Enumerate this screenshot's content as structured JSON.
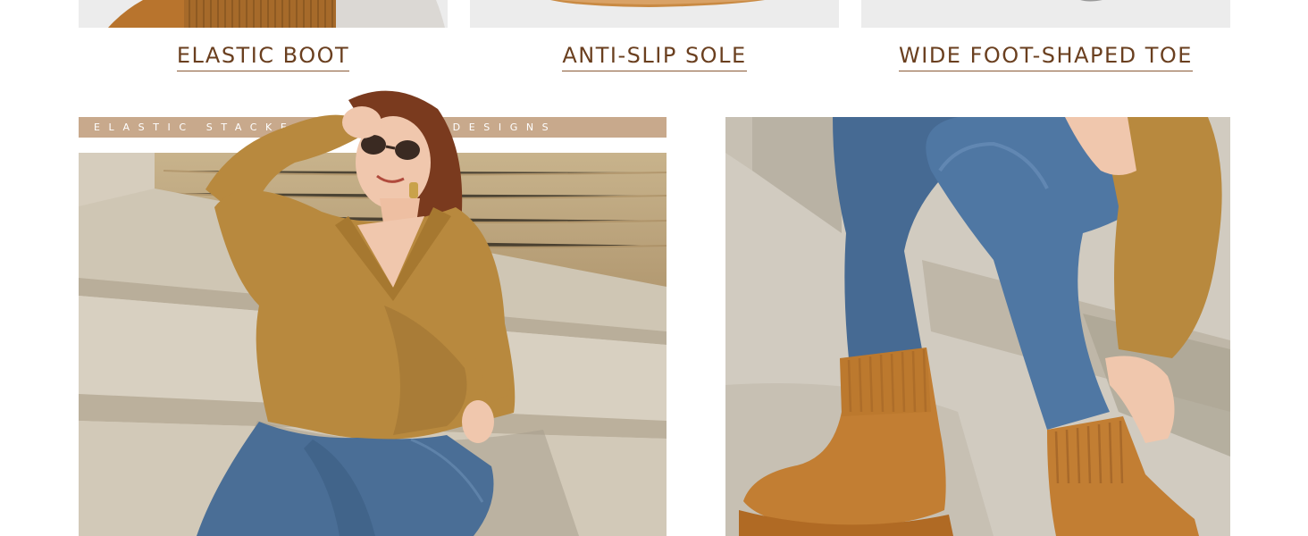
{
  "features": [
    {
      "caption": "ELASTIC BOOT",
      "image_name": "elastic-boot-closeup"
    },
    {
      "caption": "ANTI-SLIP SOLE",
      "image_name": "anti-slip-sole-closeup"
    },
    {
      "caption": "WIDE FOOT-SHAPED TOE",
      "image_name": "wide-toe-closeup"
    }
  ],
  "banner": {
    "text": "ELASTIC STACKED STRAIGHT DESIGNS"
  },
  "colors": {
    "caption": "#6a3f1f",
    "banner_bg": "#c8a98c",
    "sweater": "#b8893e",
    "denim": "#4a6e96",
    "boot": "#c27e33",
    "concrete": "#cfc7b8"
  }
}
